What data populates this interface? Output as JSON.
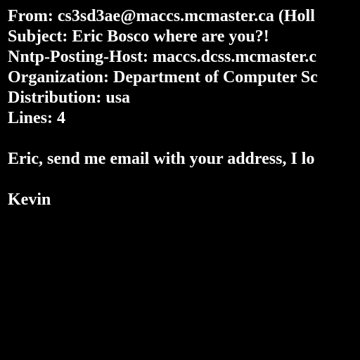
{
  "colors": {
    "background": "#000000",
    "text": "#ffffff"
  },
  "headers": {
    "from": "From: cs3sd3ae@maccs.mcmaster.ca (Holl",
    "subject": "Subject: Eric Bosco where are you?!",
    "nntp_posting_host": "Nntp-Posting-Host: maccs.dcss.mcmaster.c",
    "organization": "Organization: Department of Computer Sc",
    "distribution": "Distribution: usa",
    "lines": "Lines: 4"
  },
  "body": {
    "paragraph": "Eric, send me email with your address, I lo",
    "signature": "Kevin"
  }
}
